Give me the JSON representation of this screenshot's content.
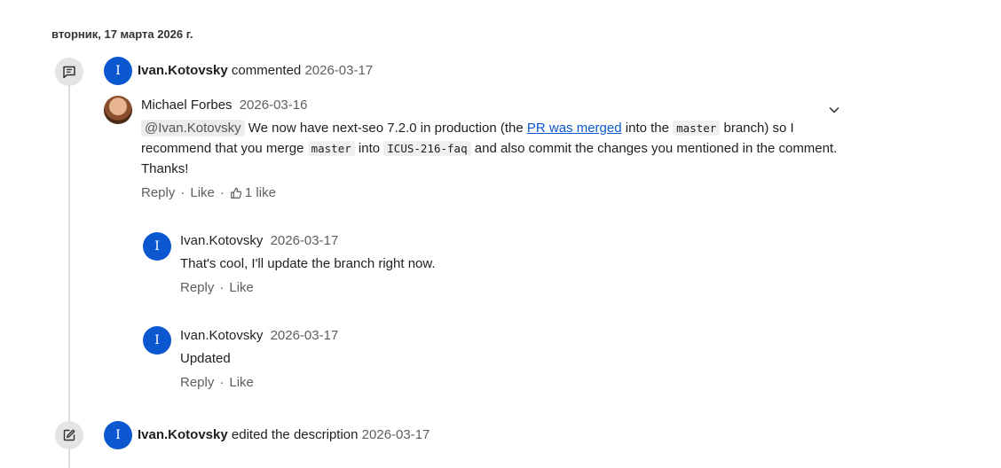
{
  "date_header": "вторник, 17 марта 2026 г.",
  "events": {
    "comment_event": {
      "avatar_letter": "I",
      "author": "Ivan.Kotovsky",
      "action": "commented",
      "date": "2026-03-17"
    },
    "edit_event": {
      "avatar_letter": "I",
      "author": "Ivan.Kotovsky",
      "action": "edited the description",
      "date": "2026-03-17"
    }
  },
  "main_comment": {
    "author": "Michael Forbes",
    "date": "2026-03-16",
    "mention": "@Ivan.Kotovsky",
    "text_1": "We now have next-seo 7.2.0 in production (the",
    "link": "PR was merged",
    "text_2": "into the",
    "code_1": "master",
    "text_3": "branch) so I",
    "text_4": "recommend that you merge",
    "code_2": "master",
    "text_5": "into",
    "code_3": "ICUS-216-faq",
    "text_6": "and also commit the changes you mentioned in the comment.",
    "text_7": "Thanks!",
    "reply_label": "Reply",
    "like_label": "Like",
    "likes_count": "1 like"
  },
  "replies": [
    {
      "avatar_letter": "I",
      "author": "Ivan.Kotovsky",
      "date": "2026-03-17",
      "text": "That's cool, I'll update the branch right now.",
      "reply_label": "Reply",
      "like_label": "Like"
    },
    {
      "avatar_letter": "I",
      "author": "Ivan.Kotovsky",
      "date": "2026-03-17",
      "text": "Updated",
      "reply_label": "Reply",
      "like_label": "Like"
    }
  ],
  "icons": {
    "comment_event": "comment-icon",
    "edit_event": "edit-icon",
    "expand": "chevron-down-icon",
    "like": "thumbs-up-icon"
  },
  "colors": {
    "avatar": "#0b57d0",
    "link": "#0b57d0",
    "timeline_icon_bg": "#e4e4e4"
  }
}
